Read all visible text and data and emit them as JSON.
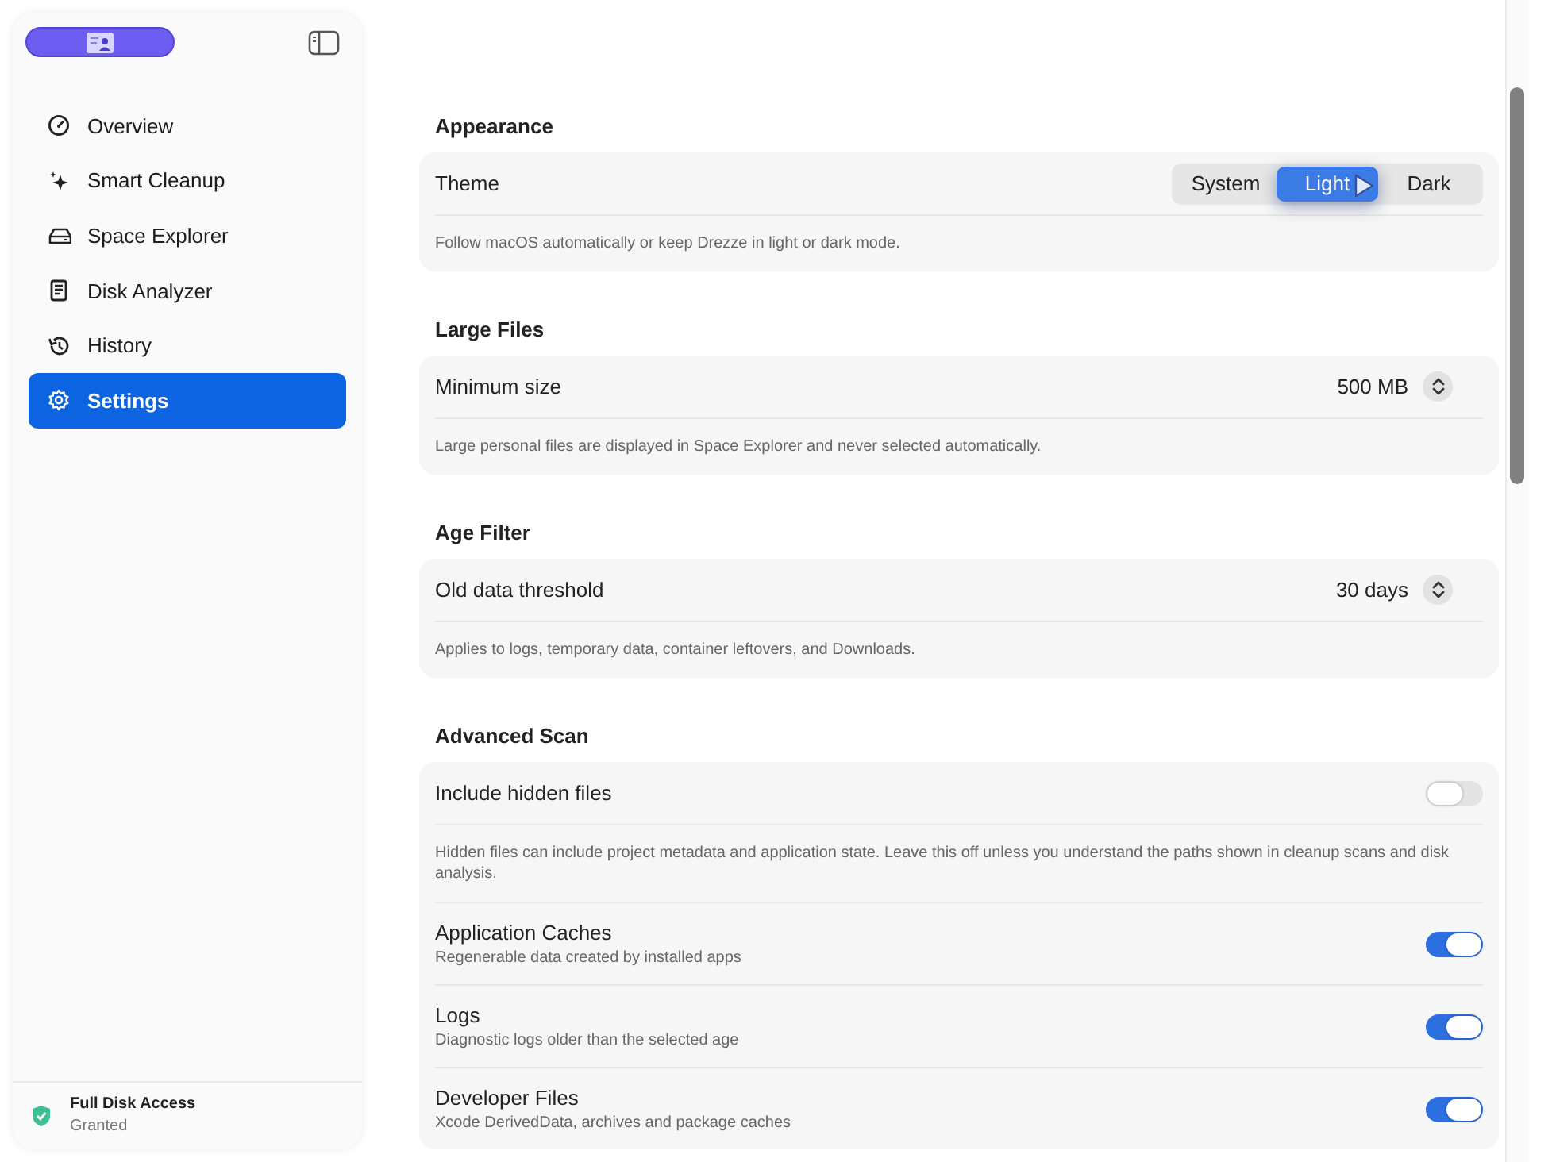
{
  "sidebar": {
    "items": [
      {
        "label": "Overview",
        "selected": false
      },
      {
        "label": "Smart Cleanup",
        "selected": false
      },
      {
        "label": "Space Explorer",
        "selected": false
      },
      {
        "label": "Disk Analyzer",
        "selected": false
      },
      {
        "label": "History",
        "selected": false
      },
      {
        "label": "Settings",
        "selected": true
      }
    ],
    "footer": {
      "title": "Full Disk Access",
      "status": "Granted"
    }
  },
  "sections": [
    {
      "title": "Appearance",
      "items": [
        {
          "kind": "segmented",
          "label": "Theme",
          "options": [
            {
              "label": "System",
              "selected": false
            },
            {
              "label": "Light",
              "selected": true
            },
            {
              "label": "Dark",
              "selected": false
            }
          ]
        },
        {
          "kind": "note",
          "text": "Follow macOS automatically or keep Drezze in light or dark mode."
        }
      ]
    },
    {
      "title": "Large Files",
      "items": [
        {
          "kind": "stepper",
          "label": "Minimum size",
          "value": "500 MB"
        },
        {
          "kind": "note",
          "text": "Large personal files are displayed in Space Explorer and never selected automatically."
        }
      ]
    },
    {
      "title": "Age Filter",
      "items": [
        {
          "kind": "stepper",
          "label": "Old data threshold",
          "value": "30 days"
        },
        {
          "kind": "note",
          "text": "Applies to logs, temporary data, container leftovers, and Downloads."
        }
      ]
    },
    {
      "title": "Advanced Scan",
      "items": [
        {
          "kind": "toggle",
          "label": "Include hidden files",
          "on": false
        },
        {
          "kind": "note",
          "text": "Hidden files can include project metadata and application state. Leave this off unless you understand the paths shown in cleanup scans and disk analysis."
        },
        {
          "kind": "toggle",
          "label": "Application Caches",
          "subtitle": "Regenerable data created by installed apps",
          "on": true
        },
        {
          "kind": "toggle",
          "label": "Logs",
          "subtitle": "Diagnostic logs older than the selected age",
          "on": true
        },
        {
          "kind": "toggle",
          "label": "Developer Files",
          "subtitle": "Xcode DerivedData, archives and package caches",
          "on": true
        }
      ]
    }
  ]
}
